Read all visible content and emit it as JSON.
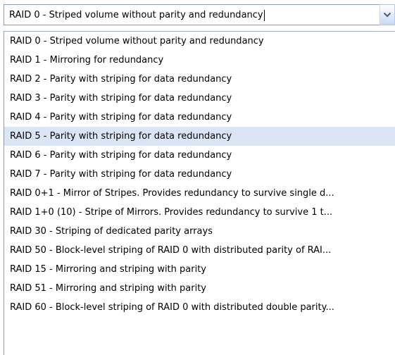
{
  "combo": {
    "value": "RAID 0 - Striped volume without parity and redundancy",
    "button_icon": "chevron-down-icon",
    "button_color": "#4d6185"
  },
  "list": {
    "selected_index": 5,
    "highlight_color": "#dbe5f6",
    "items": [
      {
        "label": "RAID 0 - Striped volume without parity and redundancy"
      },
      {
        "label": "RAID 1 - Mirroring for redundancy"
      },
      {
        "label": "RAID 2 - Parity with striping for data redundancy"
      },
      {
        "label": "RAID 3 - Parity with striping for data redundancy"
      },
      {
        "label": "RAID 4 - Parity with striping for data redundancy"
      },
      {
        "label": "RAID 5 - Parity with striping for data redundancy"
      },
      {
        "label": "RAID 6 - Parity with striping for data redundancy"
      },
      {
        "label": "RAID 7 - Parity with striping for data redundancy"
      },
      {
        "label": "RAID 0+1 - Mirror of Stripes. Provides redundancy to survive single d..."
      },
      {
        "label": "RAID 1+0 (10) - Stripe of Mirrors. Provides redundancy to survive 1 t..."
      },
      {
        "label": "RAID 30 - Striping of dedicated parity arrays"
      },
      {
        "label": "RAID 50 - Block-level striping of RAID 0 with distributed parity of RAI..."
      },
      {
        "label": "RAID 15 - Mirroring and striping with parity"
      },
      {
        "label": "RAID 51 - Mirroring and striping with parity"
      },
      {
        "label": "RAID 60 - Block-level striping of RAID 0 with distributed double parity..."
      }
    ]
  }
}
